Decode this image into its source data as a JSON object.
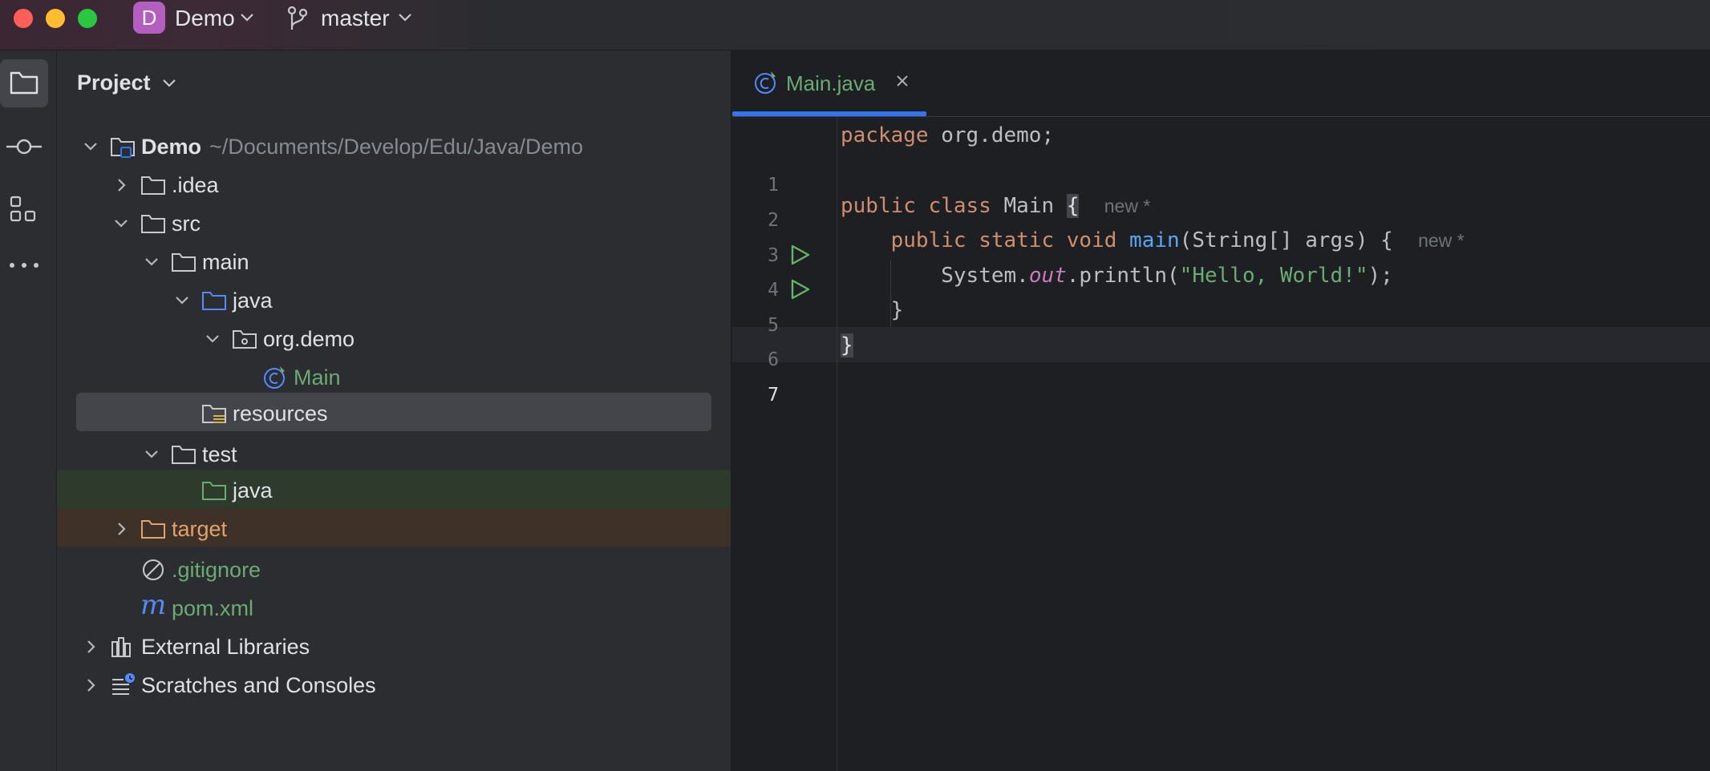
{
  "titlebar": {
    "project_badge": "D",
    "project_name": "Demo",
    "branch_name": "master"
  },
  "toolstripe": {
    "items": [
      {
        "icon": "folder-icon",
        "active": true
      },
      {
        "icon": "commit-icon",
        "active": false
      },
      {
        "icon": "structure-icon",
        "active": false
      },
      {
        "icon": "more-icon",
        "active": false
      }
    ]
  },
  "project_panel": {
    "title": "Project",
    "tree": [
      {
        "label": "Demo",
        "path": "~/Documents/Develop/Edu/Java/Demo",
        "icon": "module-folder-icon",
        "expanded": true
      },
      {
        "label": ".idea",
        "icon": "folder-icon",
        "expanded": false
      },
      {
        "label": "src",
        "icon": "folder-icon",
        "expanded": true
      },
      {
        "label": "main",
        "icon": "folder-icon",
        "expanded": true
      },
      {
        "label": "java",
        "icon": "source-folder-icon",
        "expanded": true
      },
      {
        "label": "org.demo",
        "icon": "package-icon",
        "expanded": true
      },
      {
        "label": "Main",
        "icon": "java-class-icon"
      },
      {
        "label": "resources",
        "icon": "resources-folder-icon",
        "selected": true
      },
      {
        "label": "test",
        "icon": "folder-icon",
        "expanded": true
      },
      {
        "label": "java",
        "icon": "test-source-folder-icon"
      },
      {
        "label": "target",
        "icon": "excluded-folder-icon",
        "expanded": false
      },
      {
        "label": ".gitignore",
        "icon": "ignore-file-icon"
      },
      {
        "label": "pom.xml",
        "icon": "maven-icon"
      },
      {
        "label": "External Libraries",
        "icon": "libraries-icon",
        "expanded": false
      },
      {
        "label": "Scratches and Consoles",
        "icon": "scratches-icon",
        "expanded": false
      }
    ]
  },
  "editor": {
    "tab": {
      "label": "Main.java",
      "icon": "java-class-icon"
    },
    "line_numbers": [
      "1",
      "2",
      "3",
      "4",
      "5",
      "6",
      "7"
    ],
    "current_line": "7",
    "code": {
      "l1_kw": "package",
      "l1_rest": " org.demo;",
      "l3_kw": "public class",
      "l3_name": " Main ",
      "l3_brace": "{",
      "l4_kw": "public static void",
      "l4_fn": "main",
      "l4_rest": "(String[] args) {",
      "l5_pre": "System.",
      "l5_field": "out",
      "l5_mid": ".println(",
      "l5_str": "\"Hello, World!\"",
      "l5_end": ");",
      "l6": "}",
      "l7": "}",
      "hint": "new *"
    }
  },
  "colors": {
    "accent": "#3574f0",
    "keyword": "#cf8e6d",
    "string": "#6aab73",
    "function": "#56a8f5",
    "field": "#c77dbb"
  }
}
